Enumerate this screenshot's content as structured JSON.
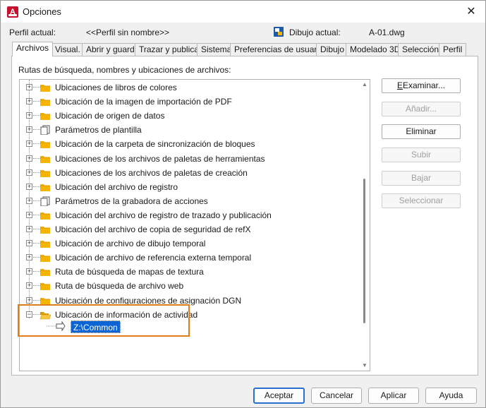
{
  "window": {
    "title": "Opciones",
    "close_glyph": "✕"
  },
  "profile": {
    "current_label": "Perfil actual:",
    "current_value": "<<Perfil sin nombre>>",
    "drawing_label": "Dibujo actual:",
    "drawing_value": "A-01.dwg"
  },
  "tabs": [
    {
      "label": "Archivos",
      "active": true
    },
    {
      "label": "Visual."
    },
    {
      "label": "Abrir y guardar"
    },
    {
      "label": "Trazar y publicar"
    },
    {
      "label": "Sistema"
    },
    {
      "label": "Preferencias de usuario"
    },
    {
      "label": "Dibujo"
    },
    {
      "label": "Modelado 3D"
    },
    {
      "label": "Selección"
    },
    {
      "label": "Perfil"
    }
  ],
  "panel_label": "Rutas de búsqueda, nombres y ubicaciones de archivos:",
  "tree": {
    "items": [
      {
        "label": "Ubicaciones de libros de colores",
        "icon": "folder-icon"
      },
      {
        "label": "Ubicación de la imagen de importación de PDF",
        "icon": "folder-icon"
      },
      {
        "label": "Ubicación de origen de datos",
        "icon": "folder-icon"
      },
      {
        "label": "Parámetros de plantilla",
        "icon": "pages-icon"
      },
      {
        "label": "Ubicación de la carpeta de sincronización de bloques",
        "icon": "folder-icon"
      },
      {
        "label": "Ubicaciones de los archivos de paletas de herramientas",
        "icon": "folder-icon"
      },
      {
        "label": "Ubicaciones de los archivos de paletas de creación",
        "icon": "folder-icon"
      },
      {
        "label": "Ubicación del archivo de registro",
        "icon": "folder-icon"
      },
      {
        "label": "Parámetros de la grabadora de acciones",
        "icon": "pages-icon"
      },
      {
        "label": "Ubicación del archivo de registro de trazado y publicación",
        "icon": "folder-icon"
      },
      {
        "label": "Ubicación del archivo de copia de seguridad de refX",
        "icon": "folder-icon"
      },
      {
        "label": "Ubicación de archivo de dibujo temporal",
        "icon": "folder-icon"
      },
      {
        "label": "Ubicación de archivo de referencia externa temporal",
        "icon": "folder-icon"
      },
      {
        "label": "Ruta de búsqueda de mapas de textura",
        "icon": "folder-icon"
      },
      {
        "label": "Ruta de búsqueda de archivo web",
        "icon": "folder-icon"
      },
      {
        "label": "Ubicación de configuraciones de asignación DGN",
        "icon": "folder-icon"
      },
      {
        "label": "Ubicación de información de actividad",
        "icon": "folder-open-icon",
        "expanded": true
      }
    ],
    "selected_child": "Z:\\Common"
  },
  "side_buttons": {
    "browse": "Examinar...",
    "add": "Añadir...",
    "remove": "Eliminar",
    "move_up": "Subir",
    "move_down": "Bajar",
    "set_current": "Seleccionar"
  },
  "bottom_buttons": {
    "ok": "Aceptar",
    "cancel": "Cancelar",
    "apply": "Aplicar",
    "help": "Ayuda"
  },
  "colors": {
    "highlight_border": "#e07d1a",
    "selection": "#0a64d4",
    "folder": "#f5b400",
    "default_button_border": "#2b6fce"
  }
}
